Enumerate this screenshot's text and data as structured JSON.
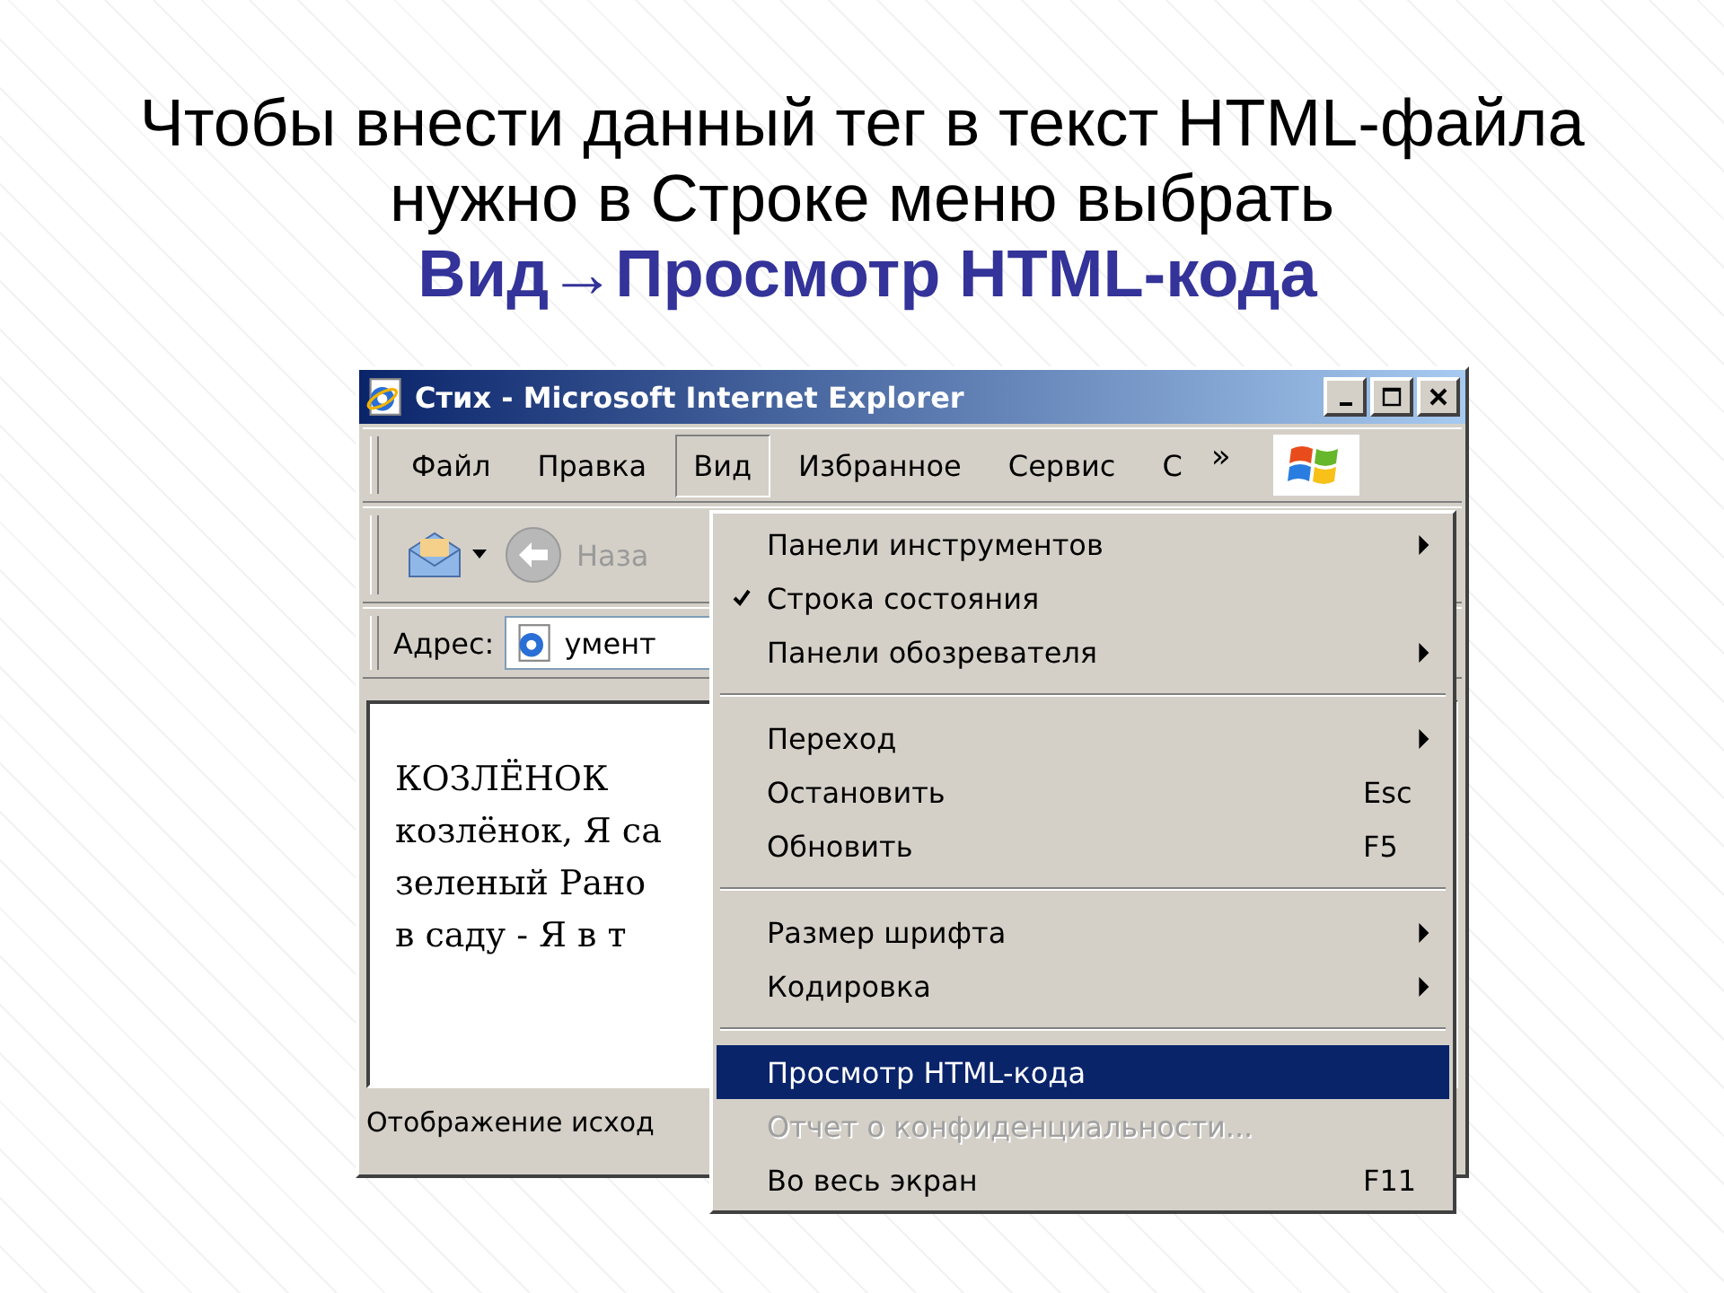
{
  "heading": {
    "lines": [
      "Чтобы внести данный тег в текст HTML-файла",
      "нужно в Строке меню выбрать"
    ],
    "highlight": "Вид→Просмотр HTML-кода"
  },
  "window": {
    "title": "Стих - Microsoft Internet Explorer",
    "menubar": [
      {
        "label": "Файл",
        "selected": false
      },
      {
        "label": "Правка",
        "selected": false
      },
      {
        "label": "Вид",
        "selected": true
      },
      {
        "label": "Избранное",
        "selected": false
      },
      {
        "label": "Сервис",
        "selected": false
      },
      {
        "label": "С",
        "selected": false
      }
    ],
    "chevron": "»",
    "back_label": "Наза",
    "address_label": "Адрес:",
    "address_value": "умент",
    "content_lines": [
      "КОЗЛЁНОК",
      "козлёнок, Я са",
      "зеленый Рано",
      "в саду - Я в т"
    ],
    "status_bar": "Отображение исход"
  },
  "menu": [
    {
      "kind": "item",
      "label": "Панели инструментов",
      "submenu": true,
      "checked": false,
      "selected": false,
      "disabled": false
    },
    {
      "kind": "item",
      "label": "Строка состояния",
      "submenu": false,
      "checked": true,
      "selected": false,
      "disabled": false
    },
    {
      "kind": "item",
      "label": "Панели обозревателя",
      "submenu": true,
      "checked": false,
      "selected": false,
      "disabled": false
    },
    {
      "kind": "separator"
    },
    {
      "kind": "item",
      "label": "Переход",
      "submenu": true,
      "checked": false,
      "selected": false,
      "disabled": false
    },
    {
      "kind": "item",
      "label": "Остановить",
      "shortcut": "Esc",
      "submenu": false,
      "checked": false,
      "selected": false,
      "disabled": false
    },
    {
      "kind": "item",
      "label": "Обновить",
      "shortcut": "F5",
      "submenu": false,
      "checked": false,
      "selected": false,
      "disabled": false
    },
    {
      "kind": "separator"
    },
    {
      "kind": "item",
      "label": "Размер шрифта",
      "submenu": true,
      "checked": false,
      "selected": false,
      "disabled": false
    },
    {
      "kind": "item",
      "label": "Кодировка",
      "submenu": true,
      "checked": false,
      "selected": false,
      "disabled": false
    },
    {
      "kind": "separator"
    },
    {
      "kind": "item",
      "label": "Просмотр HTML-кода",
      "submenu": false,
      "checked": false,
      "selected": true,
      "disabled": false
    },
    {
      "kind": "item",
      "label": "Отчет о конфиденциальности...",
      "submenu": false,
      "checked": false,
      "selected": false,
      "disabled": true
    },
    {
      "kind": "item",
      "label": "Во весь экран",
      "shortcut": "F11",
      "submenu": false,
      "checked": false,
      "selected": false,
      "disabled": false
    }
  ]
}
